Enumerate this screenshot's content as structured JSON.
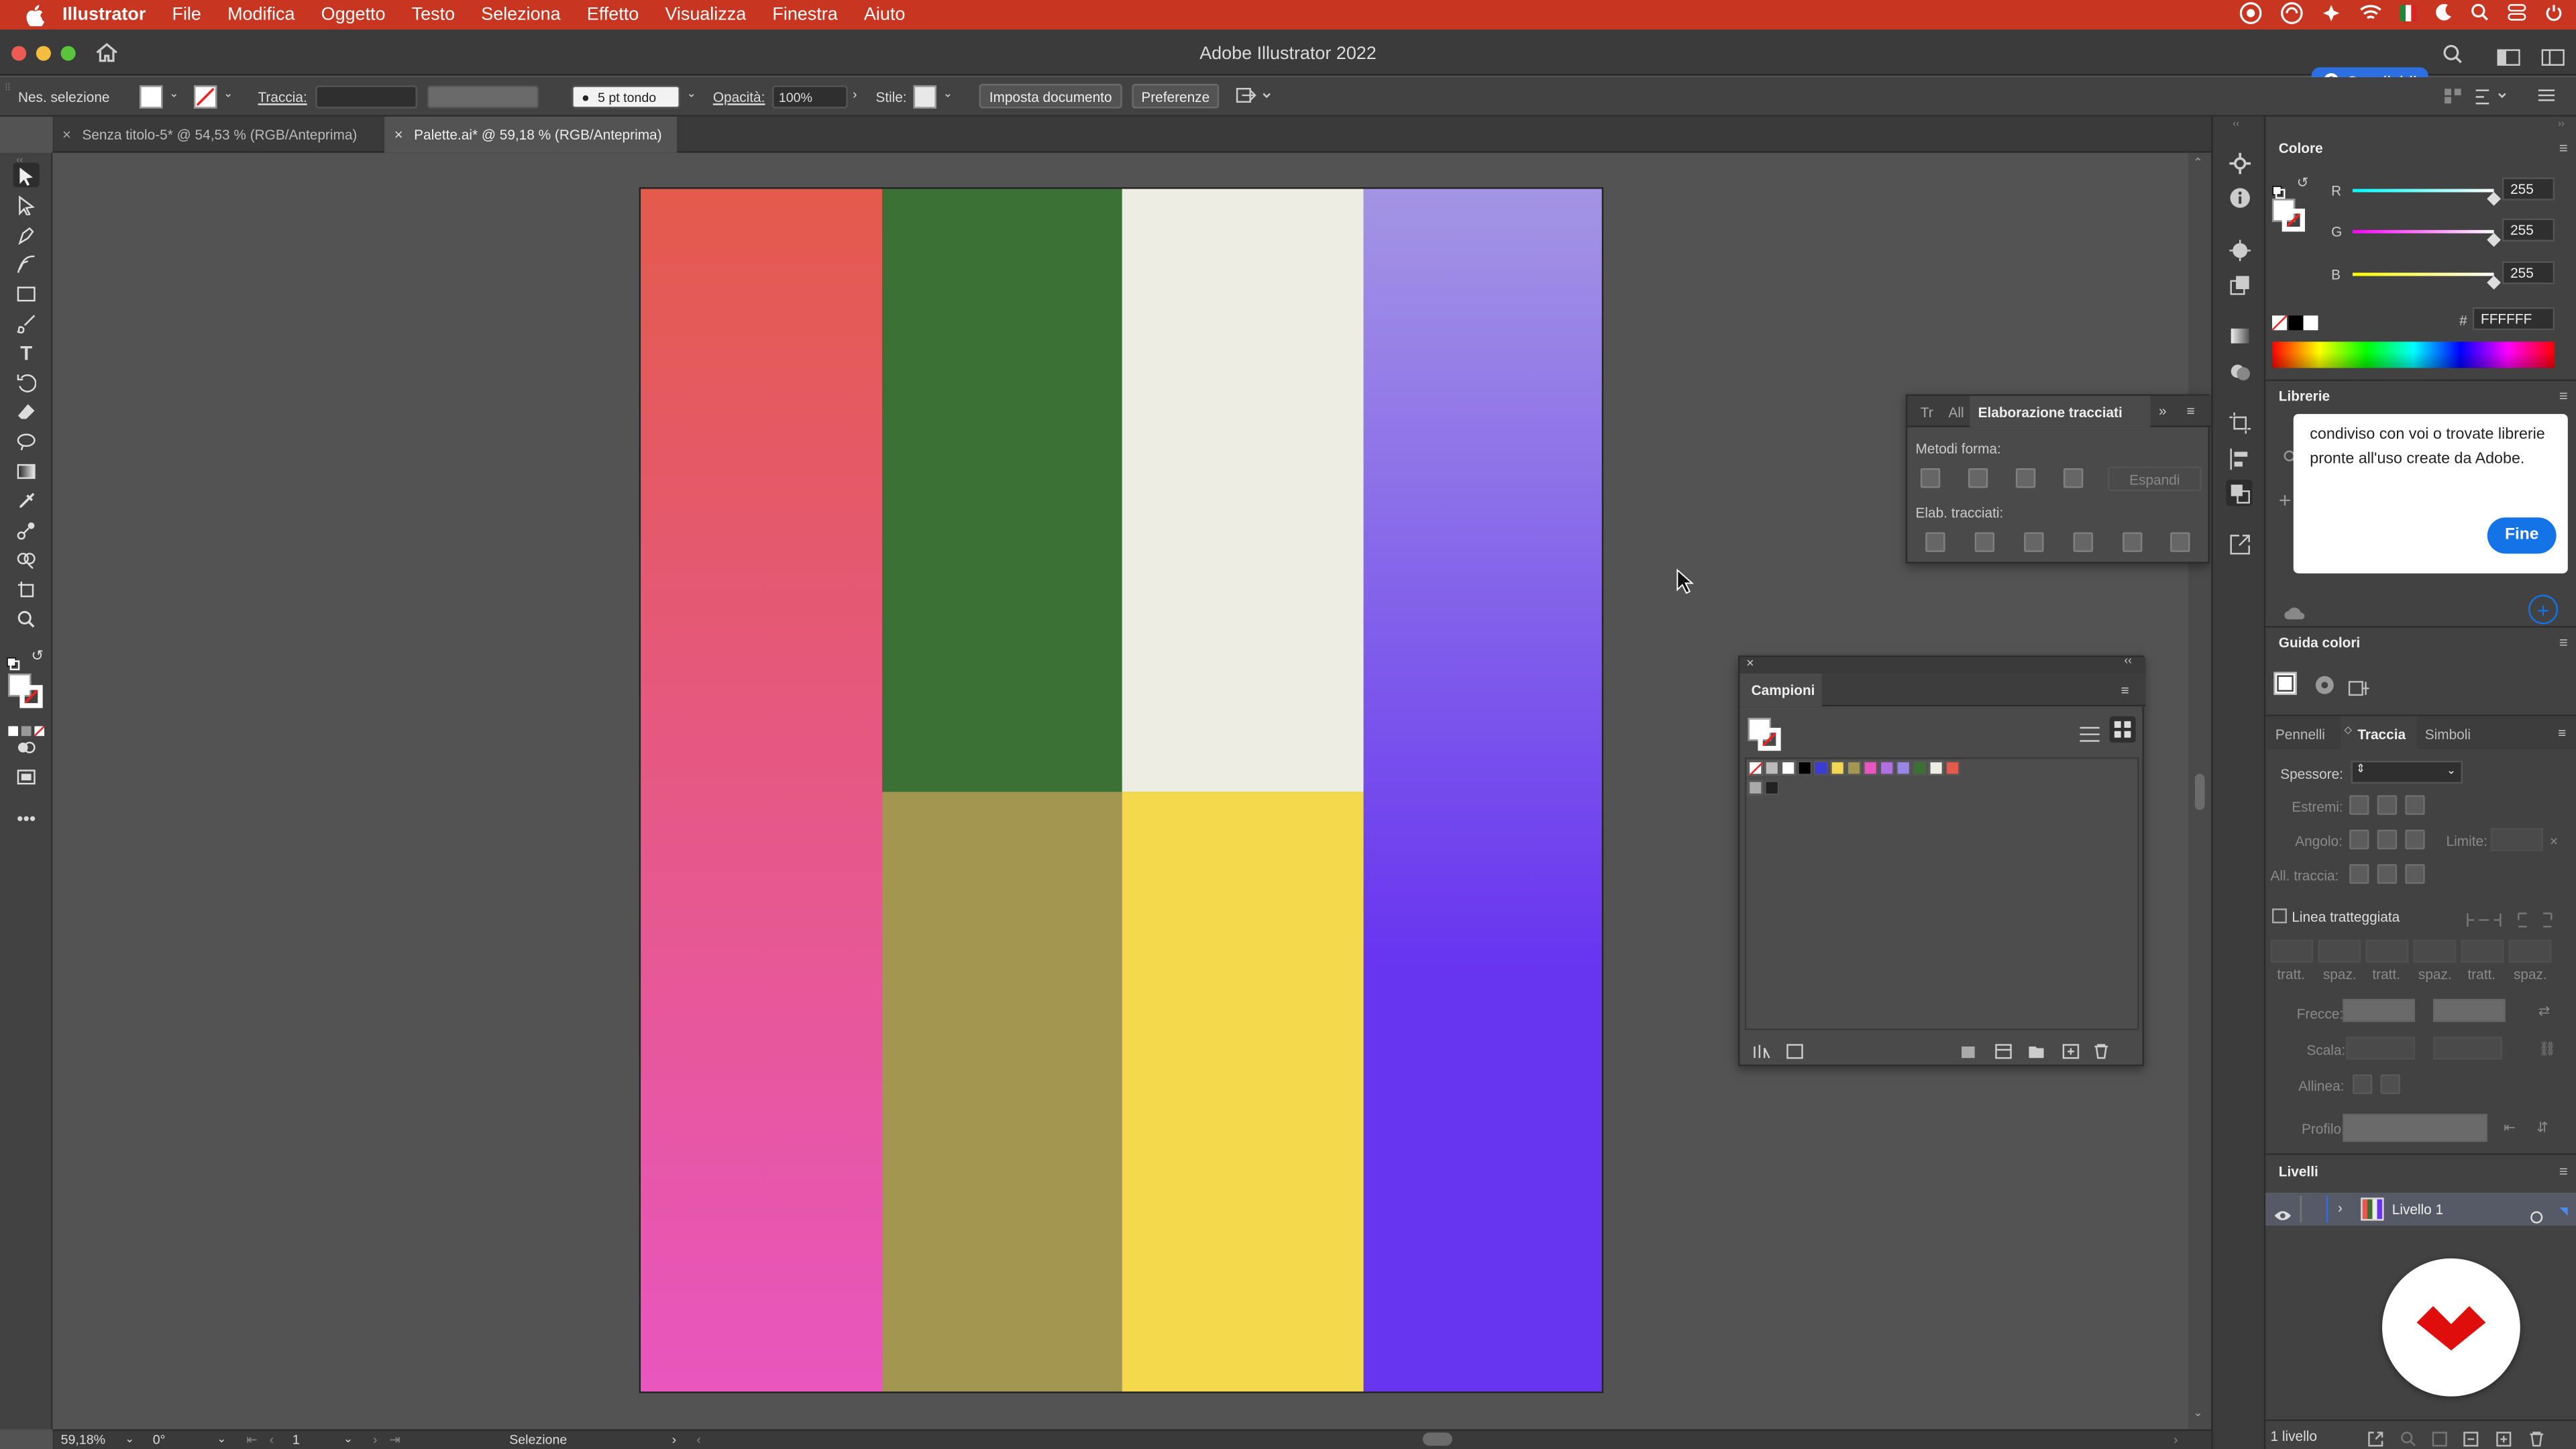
{
  "menubar": {
    "app": "Illustrator",
    "items": [
      "File",
      "Modifica",
      "Oggetto",
      "Testo",
      "Seleziona",
      "Effetto",
      "Visualizza",
      "Finestra",
      "Aiuto"
    ]
  },
  "window": {
    "title": "Adobe Illustrator 2022",
    "share_label": "Condividi"
  },
  "control": {
    "selection": "Nes. selezione",
    "stroke_label": "Traccia:",
    "brush": "5 pt tondo",
    "opacity_label": "Opacità:",
    "opacity_value": "100%",
    "style_label": "Stile:",
    "doc_setup": "Imposta documento",
    "prefs": "Preferenze"
  },
  "tabs": [
    {
      "label": "Senza titolo-5* @ 54,53 % (RGB/Anteprima)"
    },
    {
      "label": "Palette.ai* @ 59,18 % (RGB/Anteprima)"
    }
  ],
  "artboard": {
    "colors": {
      "red_top": "#e45a4c",
      "pink_bottom": "#e856bf",
      "green": "#3b7135",
      "olive": "#a39651",
      "cream": "#eeede3",
      "yellow": "#f4d94d",
      "lavender_top": "#a395e4",
      "purple_bottom": "#6734f0"
    }
  },
  "color_panel": {
    "title": "Colore",
    "r_label": "R",
    "r": "255",
    "g_label": "G",
    "g": "255",
    "b_label": "B",
    "b": "255",
    "hex_prefix": "#",
    "hex": "FFFFFF"
  },
  "libraries": {
    "title": "Librerie",
    "tooltip": "condiviso con voi o trovate librerie pronte all'uso create da Adobe.",
    "done": "Fine"
  },
  "pathfinder": {
    "tabs": [
      "Tr",
      "All",
      "Elaborazione tracciati"
    ],
    "shape_modes": "Metodi forma:",
    "expand": "Espandi",
    "pathfinders": "Elab. tracciati:"
  },
  "swatches": {
    "title": "Campioni"
  },
  "color_guide": {
    "title": "Guida colori"
  },
  "stroke_panel": {
    "tabs": [
      "Pennelli",
      "Traccia",
      "Simboli"
    ],
    "weight": "Spessore:",
    "cap": "Estremi:",
    "corner": "Angolo:",
    "limit": "Limite:",
    "align": "All. traccia:",
    "dashed": "Linea tratteggiata",
    "dash_labels": [
      "tratt.",
      "spaz.",
      "tratt.",
      "spaz.",
      "tratt.",
      "spaz."
    ],
    "arrows": "Frecce:",
    "scale": "Scala:",
    "align_arrows": "Allinea:",
    "profile": "Profilo:"
  },
  "layers": {
    "title": "Livelli",
    "layer_name": "Livello 1",
    "count": "1 livello"
  },
  "status": {
    "zoom": "59,18%",
    "rotation": "0°",
    "artboard_num": "1",
    "tool": "Selezione"
  }
}
